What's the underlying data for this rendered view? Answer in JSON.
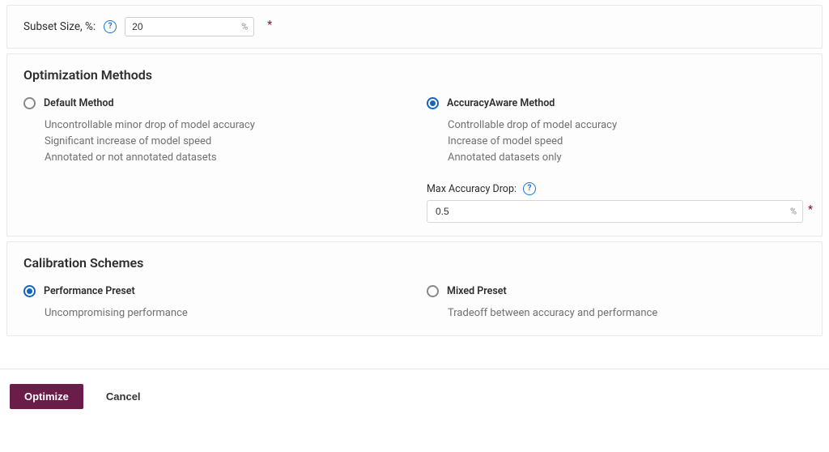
{
  "subset": {
    "label": "Subset Size, %:",
    "value": "20",
    "suffix": "%"
  },
  "methods": {
    "title": "Optimization Methods",
    "default": {
      "label": "Default Method",
      "desc": [
        "Uncontrollable minor drop of model accuracy",
        "Significant increase of model speed",
        "Annotated or not annotated datasets"
      ]
    },
    "accuracy": {
      "label": "AccuracyAware Method",
      "desc": [
        "Controllable drop of model accuracy",
        "Increase of model speed",
        "Annotated datasets only"
      ],
      "maxDropLabel": "Max Accuracy Drop:",
      "maxDropValue": "0.5",
      "suffix": "%"
    }
  },
  "schemes": {
    "title": "Calibration Schemes",
    "perf": {
      "label": "Performance Preset",
      "desc": "Uncompromising performance"
    },
    "mixed": {
      "label": "Mixed Preset",
      "desc": "Tradeoff between accuracy and performance"
    }
  },
  "actions": {
    "optimize": "Optimize",
    "cancel": "Cancel"
  },
  "glyph": {
    "required": "*"
  }
}
